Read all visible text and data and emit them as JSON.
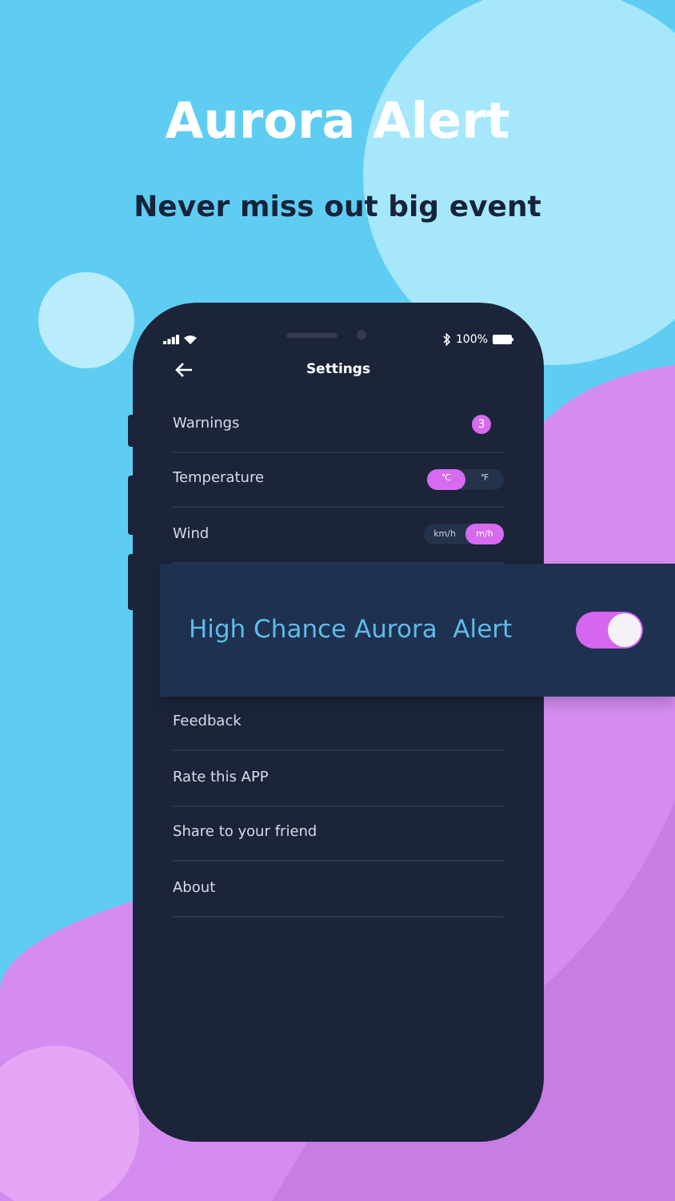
{
  "promo": {
    "title": "Aurora Alert",
    "subtitle": "Never miss out big event"
  },
  "status_bar": {
    "battery": "100%"
  },
  "header": {
    "title": "Settings"
  },
  "settings": [
    {
      "kind": "badge",
      "label": "Warnings",
      "badge": "3"
    },
    {
      "kind": "segmented",
      "label": "Temperature",
      "options": [
        {
          "label": "℃",
          "selected": true
        },
        {
          "label": "℉",
          "selected": false
        }
      ]
    },
    {
      "kind": "segmented",
      "label": "Wind",
      "options": [
        {
          "label": "km/h",
          "selected": false
        },
        {
          "label": "m/h",
          "selected": true
        }
      ]
    }
  ],
  "alert_card": {
    "label": "High Chance Aurora  Alert",
    "on": true
  },
  "links": [
    "Feedback",
    "Rate this APP",
    "Share to your friend",
    "About"
  ]
}
